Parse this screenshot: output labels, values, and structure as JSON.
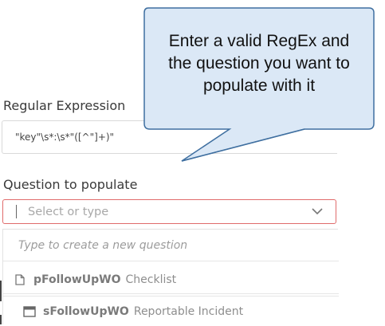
{
  "callout": {
    "lines": [
      "Enter a valid RegEx and",
      "the question you want to",
      "populate with it"
    ]
  },
  "regex": {
    "label": "Regular Expression",
    "value": "\"key\"\\s*:\\s*\"([^\"]+)\""
  },
  "question": {
    "label": "Question to populate",
    "placeholder": "Select or type"
  },
  "dropdown": {
    "hint": "Type to create a new question",
    "options": [
      {
        "icon": "document-icon",
        "name": "pFollowUpWO",
        "type": "Checklist"
      },
      {
        "icon": "window-icon",
        "name": "sFollowUpWO",
        "type": "Reportable Incident"
      }
    ]
  },
  "colors": {
    "error_border": "#e06b6b",
    "callout_fill": "#dbe8f6",
    "callout_border": "#3f6fa0"
  }
}
